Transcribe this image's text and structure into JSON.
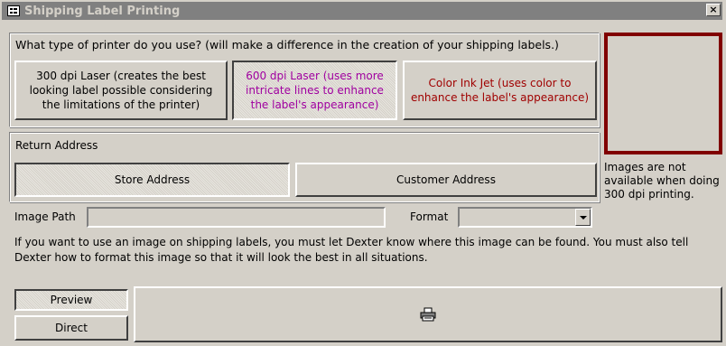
{
  "window": {
    "title": "Shipping Label Printing",
    "close": "×"
  },
  "printer": {
    "question": "What type of printer do you use? (will make a difference in the creation of your shipping labels.)",
    "options": [
      {
        "label": "300 dpi Laser (creates the best looking label possible considering the limitations of the printer)",
        "color": "#000000"
      },
      {
        "label": "600 dpi Laser (uses more intricate lines to enhance the label's appearance)",
        "color": "#a000a0"
      },
      {
        "label": "Color Ink Jet (uses color to enhance the label's appearance)",
        "color": "#a00000"
      }
    ]
  },
  "return_address": {
    "heading": "Return Address",
    "store": "Store Address",
    "customer": "Customer Address"
  },
  "image": {
    "note": "Images are not available when doing 300 dpi printing.",
    "path_label": "Image Path",
    "path_value": "",
    "format_label": "Format",
    "format_value": "",
    "border_color": "#800000"
  },
  "help_text": "If you want to use an image on shipping labels, you must let Dexter know where this image can be found. You must also tell Dexter how to format this image so that it will look the best in all situations.",
  "output": {
    "preview": "Preview",
    "direct": "Direct",
    "print_icon": "printer-icon"
  }
}
